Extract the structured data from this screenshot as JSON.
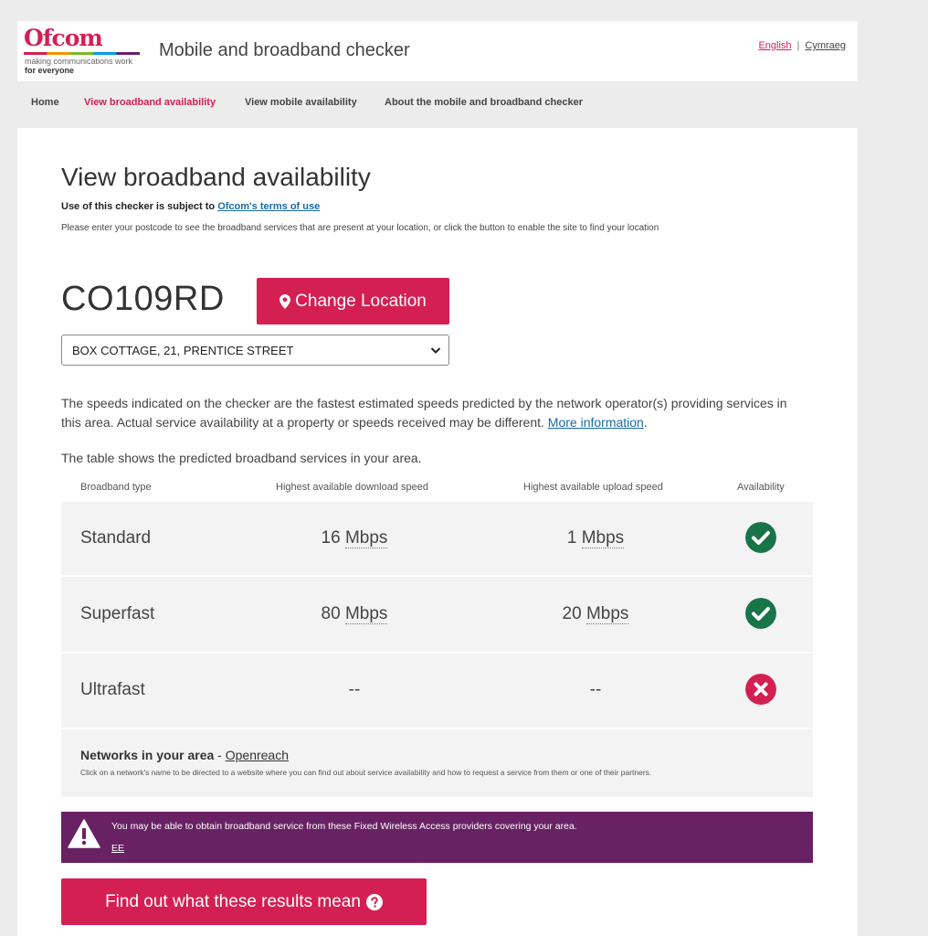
{
  "header": {
    "logo_text": "Ofcom",
    "logo_tagline_1": "making communications work",
    "logo_tagline_2": "for everyone",
    "app_title": "Mobile and broadband checker",
    "lang_english": "English",
    "lang_separator": "|",
    "lang_welsh": "Cymraeg"
  },
  "nav": {
    "items": [
      {
        "label": "Home"
      },
      {
        "label": "View broadband availability"
      },
      {
        "label": "View mobile availability"
      },
      {
        "label": "About the mobile and broadband checker"
      }
    ]
  },
  "main": {
    "title": "View broadband availability",
    "terms_prefix": "Use of this checker is subject to",
    "terms_link": "Ofcom's terms of use",
    "instructions": "Please enter your postcode to see the broadband services that are present at your location, or click the button to enable the site to find your location",
    "postcode": "CO109RD",
    "change_location_label": "Change Location",
    "address_selected": "BOX COTTAGE, 21, PRENTICE STREET",
    "speeds_note": "The speeds indicated on the checker are the fastest estimated speeds predicted by the network operator(s) providing services in this area. Actual service availability at a property or speeds received may be different.",
    "more_info_link": "More information",
    "more_info_suffix": ".",
    "table_intro": "The table shows the predicted broadband services in your area."
  },
  "table": {
    "headers": {
      "type": "Broadband type",
      "download": "Highest available download speed",
      "upload": "Highest available upload speed",
      "availability": "Availability"
    },
    "rows": [
      {
        "type": "Standard",
        "download_value": "16",
        "download_unit": "Mbps",
        "upload_value": "1",
        "upload_unit": "Mbps",
        "available": true
      },
      {
        "type": "Superfast",
        "download_value": "80",
        "download_unit": "Mbps",
        "upload_value": "20",
        "upload_unit": "Mbps",
        "available": true
      },
      {
        "type": "Ultrafast",
        "download_dash": "--",
        "upload_dash": "--",
        "available": false
      }
    ]
  },
  "networks": {
    "title": "Networks in your area",
    "separator": " - ",
    "network_link": "Openreach",
    "subtext": "Click on a network's name to be directed to a website where you can find out about service availability and how to request a service from them or one of their partners."
  },
  "fwa": {
    "message": "You may be able to obtain broadband service from these Fixed Wireless Access providers covering your area.",
    "provider_link": "EE"
  },
  "results_button_label": "Find out what these results mean",
  "colors": {
    "brand_pink": "#d41f52",
    "available_green": "#177548",
    "fwa_purple": "#682264",
    "link_blue": "#1a6aa6"
  },
  "icons": [
    "map-marker-icon",
    "chevron-down-icon",
    "check-circle-icon",
    "cross-circle-icon",
    "warning-icon",
    "question-circle-icon"
  ]
}
